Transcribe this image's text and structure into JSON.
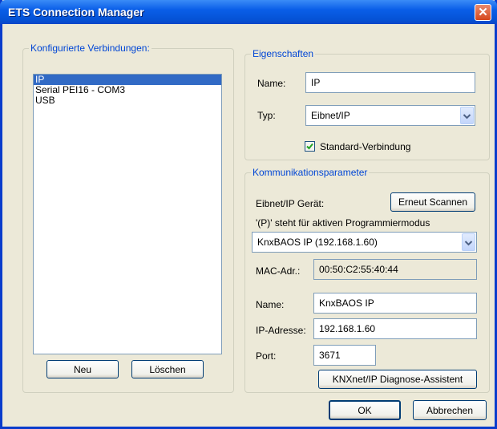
{
  "window": {
    "title": "ETS Connection Manager"
  },
  "connections": {
    "legend": "Konfigurierte Verbindungen:",
    "items": [
      "IP",
      "Serial PEI16 - COM3",
      "USB"
    ],
    "selected_index": 0,
    "new_button": "Neu",
    "delete_button": "Löschen"
  },
  "properties": {
    "legend": "Eigenschaften",
    "name_label": "Name:",
    "name_value": "IP",
    "type_label": "Typ:",
    "type_value": "Eibnet/IP",
    "default_label": "Standard-Verbindung",
    "default_checked": true
  },
  "comm": {
    "legend": "Kommunikationsparameter",
    "device_label": "Eibnet/IP Gerät:",
    "rescan_button": "Erneut Scannen",
    "hint": "'(P)' steht für aktiven Programmiermodus",
    "device_value": "KnxBAOS IP (192.168.1.60)",
    "mac_label": "MAC-Adr.:",
    "mac_value": "00:50:C2:55:40:44",
    "name_label": "Name:",
    "name_value": "KnxBAOS IP",
    "ip_label": "IP-Adresse:",
    "ip_value": "192.168.1.60",
    "port_label": "Port:",
    "port_value": "3671",
    "diag_button": "KNXnet/IP Diagnose-Assistent"
  },
  "footer": {
    "ok_button": "OK",
    "cancel_button": "Abbrechen"
  },
  "colors": {
    "title_bar": "#0553d6",
    "selection": "#316ac5",
    "legend_text": "#0046d5",
    "dialog_bg": "#ece9d8"
  }
}
